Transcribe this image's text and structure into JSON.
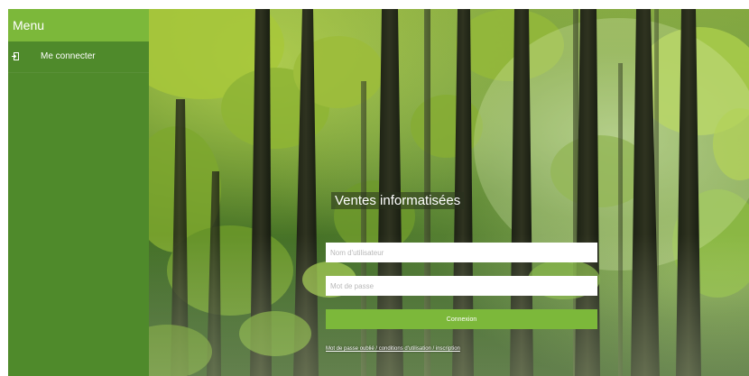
{
  "sidebar": {
    "header": "Menu",
    "items": [
      {
        "label": "Me connecter",
        "icon": "login-door-icon"
      }
    ]
  },
  "login": {
    "title": "Ventes informatisées",
    "username_placeholder": "Nom d'utilisateur",
    "password_placeholder": "Mot de passe",
    "submit_label": "Connexion",
    "forgot_link": "Mot de passe oublié / conditions d'utilisation / inscription"
  },
  "colors": {
    "sidebar_bg": "#4f8a2b",
    "sidebar_header": "#7cb83a",
    "accent": "#7cb83a"
  }
}
